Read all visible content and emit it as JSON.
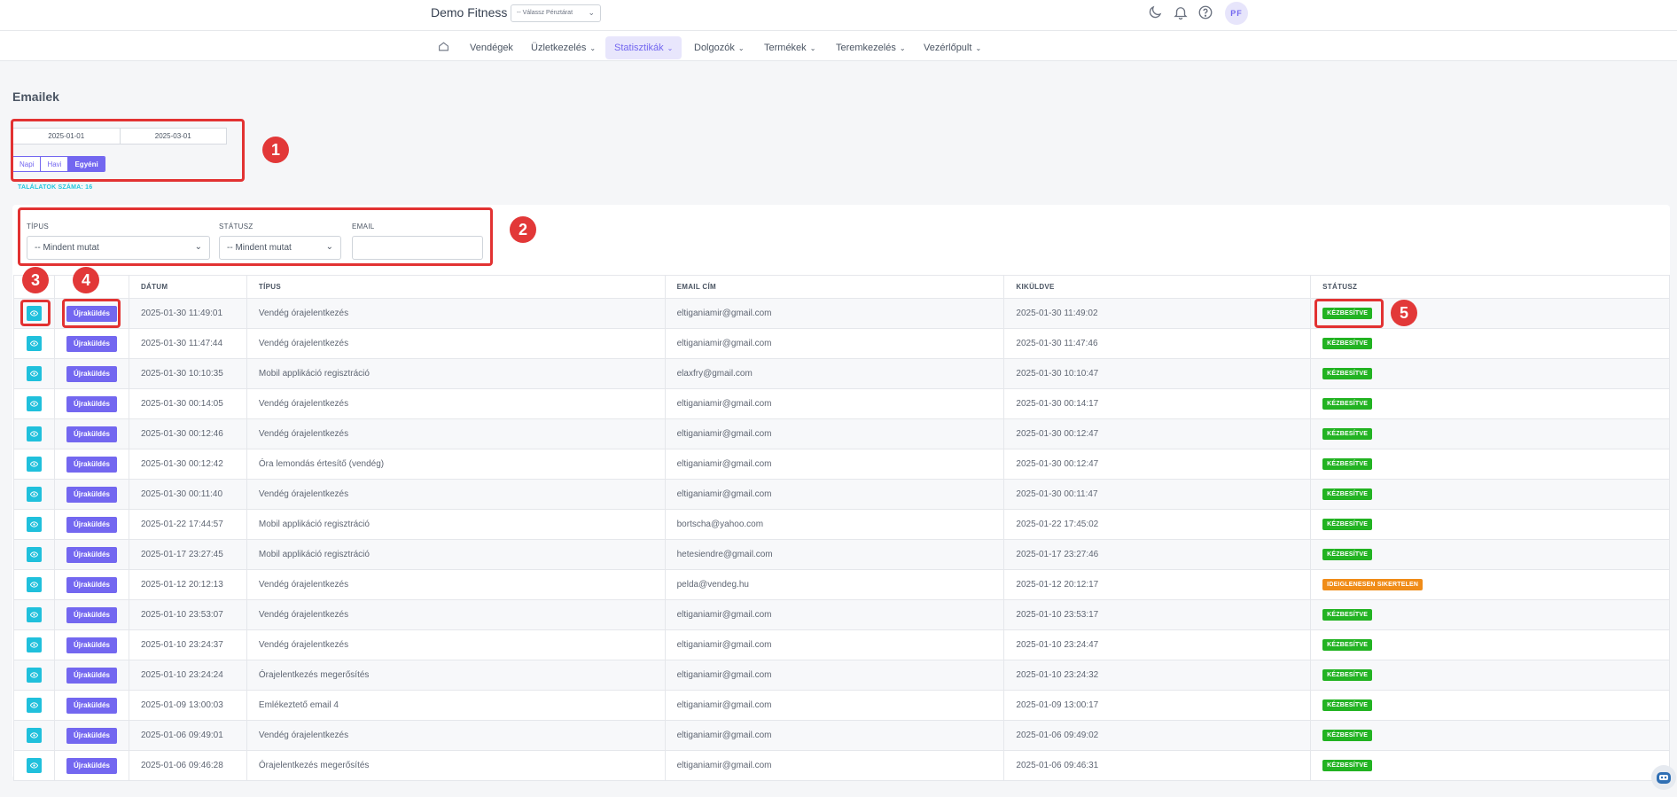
{
  "header": {
    "brand": "Demo Fitness",
    "register_select": "-- Válassz Pénztárat",
    "avatar": "PF"
  },
  "nav": {
    "items": [
      {
        "label": "Vendégek",
        "caret": false
      },
      {
        "label": "Üzletkezelés",
        "caret": true
      },
      {
        "label": "Statisztikák",
        "caret": true,
        "active": true
      },
      {
        "label": "Dolgozók",
        "caret": true
      },
      {
        "label": "Termékek",
        "caret": true
      },
      {
        "label": "Teremkezelés",
        "caret": true
      },
      {
        "label": "Vezérlőpult",
        "caret": true
      }
    ]
  },
  "page": {
    "title": "Emailek",
    "date_from": "2025-01-01",
    "date_to": "2025-03-01",
    "periods": [
      "Napi",
      "Havi",
      "Egyéni"
    ],
    "active_period": "Egyéni",
    "results": "TALÁLATOK SZÁMA: 16"
  },
  "filters": {
    "type_label": "TÍPUS",
    "type_value": "-- Mindent mutat",
    "status_label": "STÁTUSZ",
    "status_value": "-- Mindent mutat",
    "email_label": "EMAIL",
    "email_value": ""
  },
  "table": {
    "headers": [
      "",
      "",
      "DÁTUM",
      "TÍPUS",
      "EMAIL CÍM",
      "KIKÜLDVE",
      "STÁTUSZ"
    ],
    "resend_label": "Újraküldés",
    "rows": [
      {
        "date": "2025-01-30 11:49:01",
        "type": "Vendég órajelentkezés",
        "email": "eltiganiamir@gmail.com",
        "sent": "2025-01-30 11:49:02",
        "status": "KÉZBESÍTVE",
        "status_kind": "ok"
      },
      {
        "date": "2025-01-30 11:47:44",
        "type": "Vendég órajelentkezés",
        "email": "eltiganiamir@gmail.com",
        "sent": "2025-01-30 11:47:46",
        "status": "KÉZBESÍTVE",
        "status_kind": "ok"
      },
      {
        "date": "2025-01-30 10:10:35",
        "type": "Mobil applikáció regisztráció",
        "email": "elaxfry@gmail.com",
        "sent": "2025-01-30 10:10:47",
        "status": "KÉZBESÍTVE",
        "status_kind": "ok"
      },
      {
        "date": "2025-01-30 00:14:05",
        "type": "Vendég órajelentkezés",
        "email": "eltiganiamir@gmail.com",
        "sent": "2025-01-30 00:14:17",
        "status": "KÉZBESÍTVE",
        "status_kind": "ok"
      },
      {
        "date": "2025-01-30 00:12:46",
        "type": "Vendég órajelentkezés",
        "email": "eltiganiamir@gmail.com",
        "sent": "2025-01-30 00:12:47",
        "status": "KÉZBESÍTVE",
        "status_kind": "ok"
      },
      {
        "date": "2025-01-30 00:12:42",
        "type": "Óra lemondás értesítő (vendég)",
        "email": "eltiganiamir@gmail.com",
        "sent": "2025-01-30 00:12:47",
        "status": "KÉZBESÍTVE",
        "status_kind": "ok"
      },
      {
        "date": "2025-01-30 00:11:40",
        "type": "Vendég órajelentkezés",
        "email": "eltiganiamir@gmail.com",
        "sent": "2025-01-30 00:11:47",
        "status": "KÉZBESÍTVE",
        "status_kind": "ok"
      },
      {
        "date": "2025-01-22 17:44:57",
        "type": "Mobil applikáció regisztráció",
        "email": "bortscha@yahoo.com",
        "sent": "2025-01-22 17:45:02",
        "status": "KÉZBESÍTVE",
        "status_kind": "ok"
      },
      {
        "date": "2025-01-17 23:27:45",
        "type": "Mobil applikáció regisztráció",
        "email": "hetesiendre@gmail.com",
        "sent": "2025-01-17 23:27:46",
        "status": "KÉZBESÍTVE",
        "status_kind": "ok"
      },
      {
        "date": "2025-01-12 20:12:13",
        "type": "Vendég órajelentkezés",
        "email": "pelda@vendeg.hu",
        "sent": "2025-01-12 20:12:17",
        "status": "IDEIGLENESEN SIKERTELEN",
        "status_kind": "warn"
      },
      {
        "date": "2025-01-10 23:53:07",
        "type": "Vendég órajelentkezés",
        "email": "eltiganiamir@gmail.com",
        "sent": "2025-01-10 23:53:17",
        "status": "KÉZBESÍTVE",
        "status_kind": "ok"
      },
      {
        "date": "2025-01-10 23:24:37",
        "type": "Vendég órajelentkezés",
        "email": "eltiganiamir@gmail.com",
        "sent": "2025-01-10 23:24:47",
        "status": "KÉZBESÍTVE",
        "status_kind": "ok"
      },
      {
        "date": "2025-01-10 23:24:24",
        "type": "Órajelentkezés megerősítés",
        "email": "eltiganiamir@gmail.com",
        "sent": "2025-01-10 23:24:32",
        "status": "KÉZBESÍTVE",
        "status_kind": "ok"
      },
      {
        "date": "2025-01-09 13:00:03",
        "type": "Emlékeztető email 4",
        "email": "eltiganiamir@gmail.com",
        "sent": "2025-01-09 13:00:17",
        "status": "KÉZBESÍTVE",
        "status_kind": "ok"
      },
      {
        "date": "2025-01-06 09:49:01",
        "type": "Vendég órajelentkezés",
        "email": "eltiganiamir@gmail.com",
        "sent": "2025-01-06 09:49:02",
        "status": "KÉZBESÍTVE",
        "status_kind": "ok"
      },
      {
        "date": "2025-01-06 09:46:28",
        "type": "Órajelentkezés megerősítés",
        "email": "eltiganiamir@gmail.com",
        "sent": "2025-01-06 09:46:31",
        "status": "KÉZBESÍTVE",
        "status_kind": "ok"
      }
    ]
  },
  "annotations": [
    "1",
    "2",
    "3",
    "4",
    "5"
  ],
  "colors": {
    "accent": "#7367f0",
    "info": "#20c0dc",
    "success": "#22b322",
    "warning": "#f08c18",
    "annotation": "#e23232"
  }
}
